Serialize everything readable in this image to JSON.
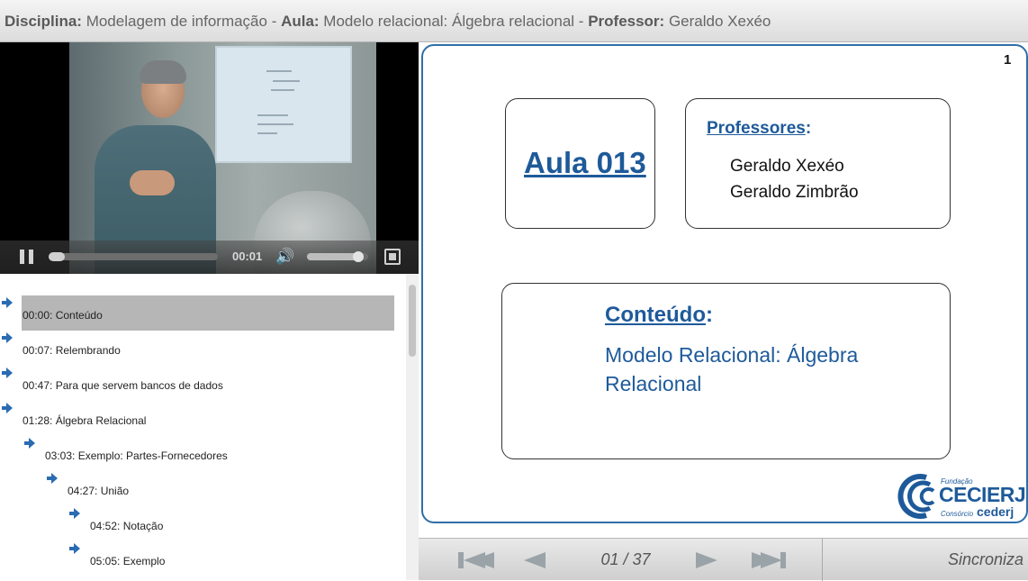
{
  "header": {
    "disciplina_label": "Disciplina:",
    "disciplina_value": " Modelagem de informação - ",
    "aula_label": "Aula:",
    "aula_value": " Modelo relacional: Álgebra relacional - ",
    "professor_label": "Professor:",
    "professor_value": " Geraldo Xexéo"
  },
  "video": {
    "current_time": "00:01",
    "progress_fraction": 0.0,
    "volume_fraction": 0.9,
    "icons": {
      "pause": "pause-icon",
      "volume": "volume-icon",
      "fullscreen": "fullscreen-icon"
    }
  },
  "chapters": [
    {
      "label": "00:00: Conteúdo",
      "level": 0,
      "active": true
    },
    {
      "label": "00:07: Relembrando",
      "level": 0,
      "active": false
    },
    {
      "label": "00:47: Para que servem bancos de dados",
      "level": 0,
      "active": false
    },
    {
      "label": "01:28: Álgebra Relacional",
      "level": 0,
      "active": false
    },
    {
      "label": "03:03: Exemplo: Partes-Fornecedores",
      "level": 1,
      "active": false
    },
    {
      "label": "04:27: União",
      "level": 2,
      "active": false
    },
    {
      "label": "04:52: Notação",
      "level": 3,
      "active": false
    },
    {
      "label": "05:05: Exemplo",
      "level": 3,
      "active": false
    }
  ],
  "slide": {
    "number": "1",
    "aula_title": "Aula 013",
    "professores_label": "Professores",
    "professores_colon": ":",
    "professores": [
      "Geraldo Xexéo",
      "Geraldo Zimbrão"
    ],
    "conteudo_label": "Conteúdo",
    "conteudo_colon": ":",
    "conteudo_text": "Modelo Relacional: Álgebra Relacional",
    "logo": {
      "fundacao": "Fundação",
      "name": "CECIERJ",
      "consorcio": "Consórcio",
      "cederj": "cederj"
    }
  },
  "nav": {
    "page_indicator": "01 / 37",
    "sync_label": "Sincroniza",
    "icons": {
      "first": "skip-to-first-icon",
      "prev": "previous-icon",
      "next": "next-icon",
      "last": "skip-to-last-icon"
    }
  },
  "colors": {
    "accent_blue": "#1e5a9a",
    "slide_border": "#2f6fa8",
    "chapter_arrow": "#2a6cb2",
    "active_row": "#b6b6b6"
  }
}
